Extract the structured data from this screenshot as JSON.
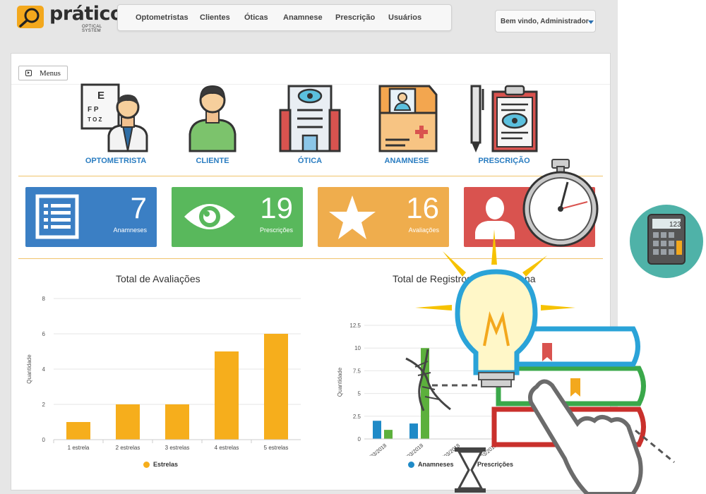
{
  "brand": {
    "name": "prático",
    "tagline": "OPTICAL SYSTEM"
  },
  "nav": {
    "items": [
      "Optometristas",
      "Clientes",
      "Óticas",
      "Anamnese",
      "Prescrição",
      "Usuários"
    ]
  },
  "user_menu": {
    "label": "Bem vindo, Administrador"
  },
  "menus_button": {
    "label": "Menus"
  },
  "shortcuts": [
    {
      "label": "OPTOMETRISTA",
      "icon": "optometrist-icon"
    },
    {
      "label": "CLIENTE",
      "icon": "client-icon"
    },
    {
      "label": "ÓTICA",
      "icon": "optical-store-icon"
    },
    {
      "label": "ANAMNESE",
      "icon": "anamnesis-folder-icon"
    },
    {
      "label": "PRESCRIÇÃO",
      "icon": "prescription-clipboard-icon"
    }
  ],
  "stats": [
    {
      "value": "7",
      "label": "Anamneses",
      "color": "#3b7fc4",
      "icon": "list-icon"
    },
    {
      "value": "19",
      "label": "Prescrições",
      "color": "#59b85c",
      "icon": "eye-icon"
    },
    {
      "value": "16",
      "label": "Avaliações",
      "color": "#efad4d",
      "icon": "star-icon"
    },
    {
      "value": "",
      "label": "",
      "color": "#d9534f",
      "icon": "user-icon"
    }
  ],
  "colors": {
    "accent_blue": "#2a7dc1",
    "bar_gold": "#f6ae1c",
    "series_blue": "#1f8ac7",
    "series_green": "#5cb03c"
  },
  "chart_data": [
    {
      "type": "bar",
      "title": "Total de Avaliações",
      "ylabel": "Quantidade",
      "xlabel": "",
      "categories": [
        "1 estrela",
        "2 estrelas",
        "3 estrelas",
        "4 estrelas",
        "5 estrelas"
      ],
      "series": [
        {
          "name": "Estrelas",
          "values": [
            1,
            2,
            2,
            5,
            6
          ]
        }
      ],
      "ylim": [
        0,
        8
      ],
      "yticks": [
        "0",
        "2",
        "4",
        "6",
        "8"
      ],
      "grid": true,
      "legend": "bottom"
    },
    {
      "type": "bar",
      "title_visible": "Total de Registros",
      "title_end": "na",
      "ylabel": "Quantidade",
      "categories": [
        "Segunda - 26/03/2018",
        "Terça - 27/03/2018",
        "Quarta - 28/03/2018",
        "Quinta - 29/03/2018"
      ],
      "series": [
        {
          "name": "Anamneses",
          "values": [
            2,
            1.7,
            0,
            0
          ]
        },
        {
          "name": "Prescrições",
          "values": [
            1,
            10,
            0,
            0
          ]
        }
      ],
      "ylim": [
        0,
        12.5
      ],
      "yticks": [
        "0",
        "2.5",
        "5",
        "7.5",
        "10",
        "12.5"
      ],
      "grid": true,
      "legend": "bottom"
    }
  ],
  "decor": {
    "calculator_display": "123"
  }
}
